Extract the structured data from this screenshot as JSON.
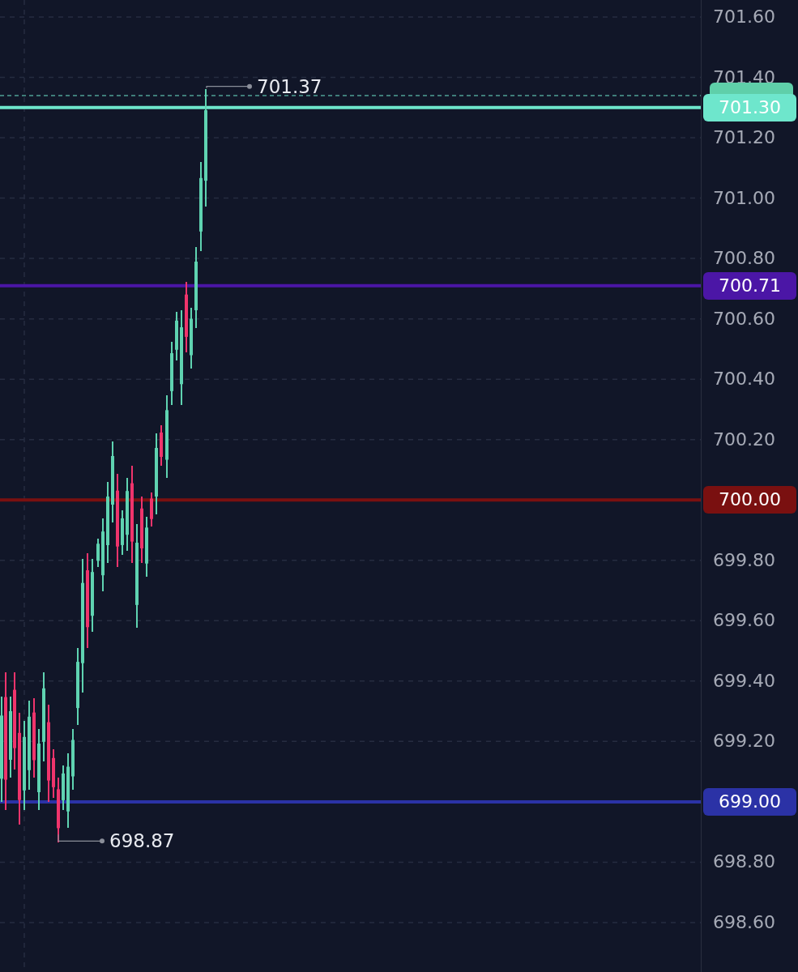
{
  "price_axis": {
    "ticks": [
      "701.60",
      "701.40",
      "701.20",
      "701.00",
      "700.80",
      "700.60",
      "700.40",
      "700.20",
      "699.80",
      "699.60",
      "699.40",
      "699.20",
      "698.80",
      "698.60"
    ]
  },
  "price_lines": [
    {
      "label": "701.30",
      "color": "#6ee6cc"
    },
    {
      "label": "700.71",
      "color": "#4b16a6"
    },
    {
      "label": "700.00",
      "color": "#7a1010"
    },
    {
      "label": "699.00",
      "color": "#2b32a6"
    }
  ],
  "markers": [
    {
      "kind": "high",
      "label": "701.37"
    },
    {
      "kind": "low",
      "label": "698.87"
    }
  ]
}
